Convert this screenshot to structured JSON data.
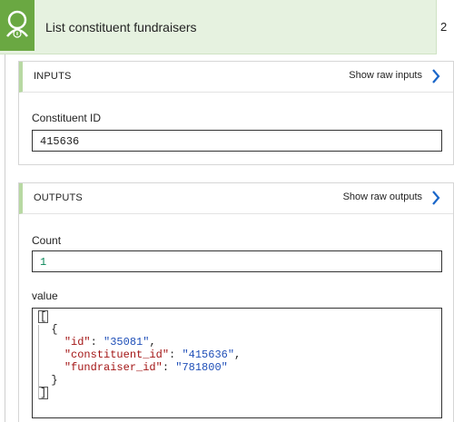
{
  "header": {
    "title": "List constituent fundraisers",
    "right_number": "2",
    "icon": "person-info-icon",
    "accent": "#6aa842"
  },
  "inputs": {
    "title": "INPUTS",
    "show_raw_label": "Show raw inputs",
    "fields": [
      {
        "label": "Constituent ID",
        "value": "415636"
      }
    ]
  },
  "outputs": {
    "title": "OUTPUTS",
    "show_raw_label": "Show raw outputs",
    "count_label": "Count",
    "count_value": "1",
    "value_label": "value",
    "value_lines": {
      "open_bracket": "[",
      "open_brace": "  {",
      "id_key": "\"id\"",
      "id_val": "\"35081\"",
      "constituent_key": "\"constituent_id\"",
      "constituent_val": "\"415636\"",
      "fundraiser_key": "\"fundraiser_id\"",
      "fundraiser_val": "\"781800\"",
      "close_brace": "  }",
      "close_bracket": "]"
    }
  }
}
